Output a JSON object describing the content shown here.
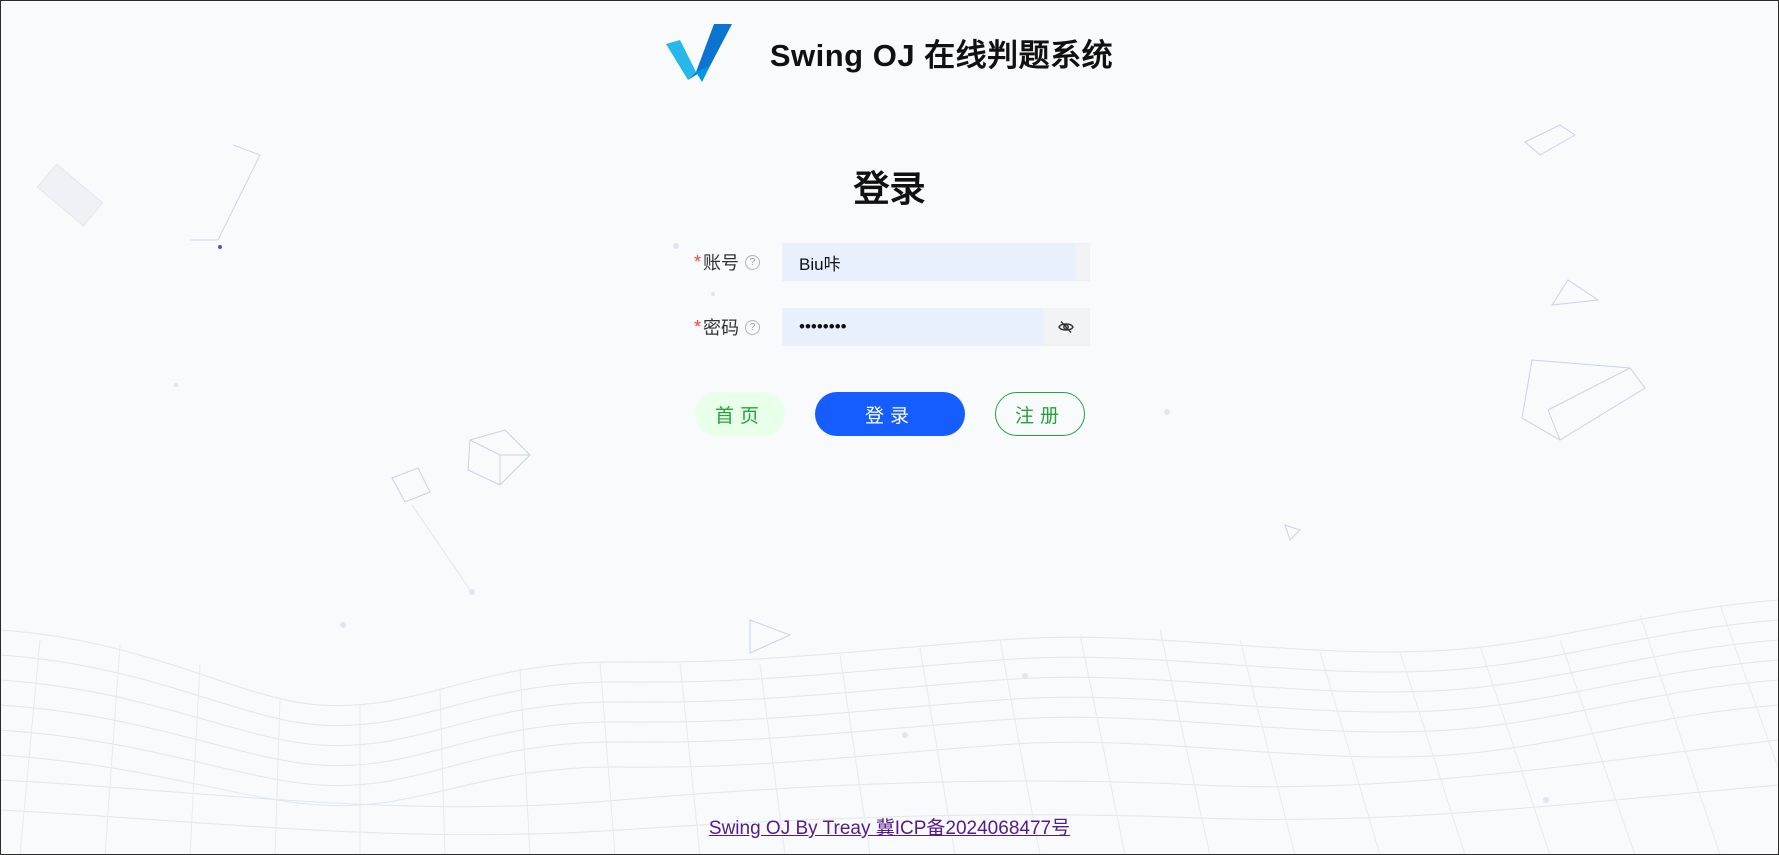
{
  "header": {
    "app_title": "Swing OJ 在线判题系统",
    "logo_colors": [
      "#0099d9",
      "#1e6fd6",
      "#28b7ea"
    ]
  },
  "login": {
    "title": "登录",
    "account": {
      "label": "账号",
      "value": "Biu咔",
      "required_mark": "*",
      "help_glyph": "?"
    },
    "password": {
      "label": "密码",
      "value": "••••••••",
      "required_mark": "*",
      "help_glyph": "?"
    },
    "buttons": {
      "home": "首页",
      "login": "登录",
      "register": "注册"
    }
  },
  "footer": {
    "text": "Swing OJ By Treay 冀ICP备2024068477号"
  },
  "colors": {
    "primary": "#165dff",
    "success": "#23a33a",
    "success_light": "#e8ffea",
    "required": "#f53f3f",
    "input_autofill": "#e8f0fe"
  },
  "icons": {
    "password_toggle": "eye-off-icon",
    "help": "question-circle-icon"
  }
}
